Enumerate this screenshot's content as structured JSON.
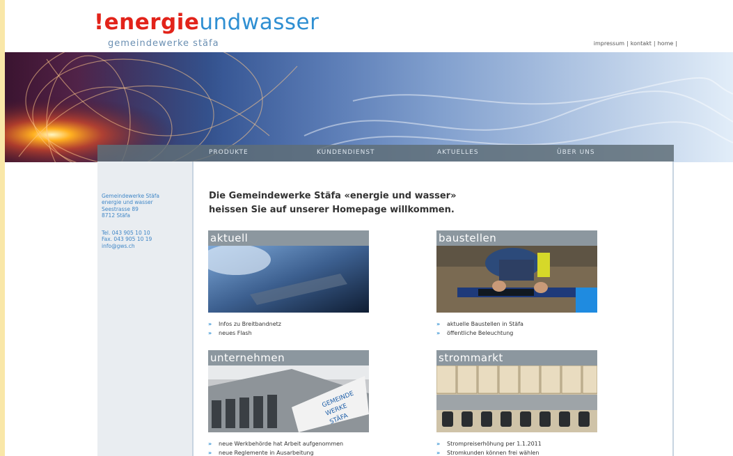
{
  "header": {
    "logo_excl": "!",
    "logo_energie": "energie",
    "logo_und": "und",
    "logo_wasser": "wasser",
    "logo_subtitle": "gemeindewerke stäfa",
    "utility_links": [
      "impressum",
      "kontakt",
      "home"
    ]
  },
  "nav": {
    "items": [
      "Produkte",
      "Kundendienst",
      "Aktuelles",
      "Über uns"
    ]
  },
  "sidebar": {
    "contact_lines_1": [
      "Gemeindewerke Stäfa",
      "energie und wasser",
      "Seestrasse 89",
      "8712 Stäfa"
    ],
    "contact_lines_2": [
      "Tel. 043 905 10 10",
      "Fax. 043 905 10 19",
      "info@gws.ch"
    ]
  },
  "main": {
    "headline_line1": "Die Gemeindewerke Stäfa «energie und wasser»",
    "headline_line2": "heissen Sie auf unserer Homepage willkommen.",
    "boxes": [
      {
        "title": "aktuell",
        "links": [
          "Infos zu Breitbandnetz",
          "neues Flash"
        ]
      },
      {
        "title": "baustellen",
        "links": [
          "aktuelle Baustellen in Stäfa",
          "öffentliche Beleuchtung"
        ]
      },
      {
        "title": "unternehmen",
        "links": [
          "neue Werkbehörde hat Arbeit aufgenommen",
          "neue Reglemente in Ausarbeitung"
        ]
      },
      {
        "title": "strommarkt",
        "links": [
          "Strompreiserhöhung per 1.1.2011",
          "Stromkunden können frei wählen"
        ]
      }
    ]
  },
  "colors": {
    "brand_red": "#e2231a",
    "brand_blue": "#2f8fd2",
    "nav_bar": "#5f6e78",
    "box_title": "#8c979f"
  }
}
